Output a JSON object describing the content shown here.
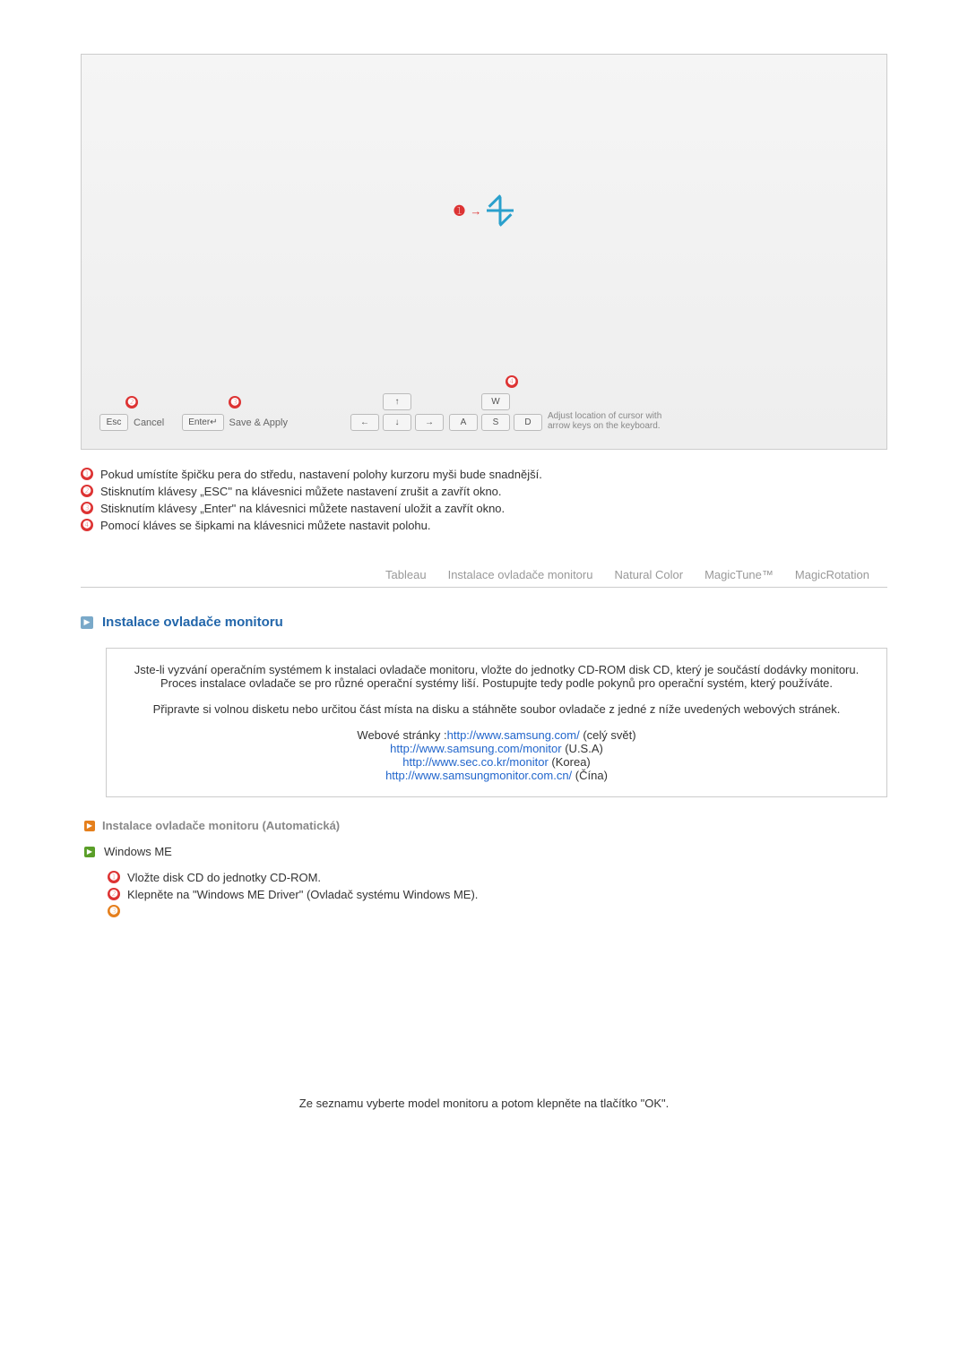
{
  "calibration_panel": {
    "marker_label_1": "➊",
    "footer": {
      "marker_2": "➋",
      "marker_3": "➌",
      "marker_4": "➍",
      "esc_key": "Esc",
      "cancel_label": "Cancel",
      "enter_key": "Enter↵",
      "save_apply_label": "Save & Apply",
      "up_key": "↑",
      "left_key": "←",
      "down_key": "↓",
      "right_key": "→",
      "w_key": "W",
      "a_key": "A",
      "s_key": "S",
      "d_key": "D",
      "adjust_text": "Adjust location of cursor with arrow keys on the keyboard."
    }
  },
  "bullets": {
    "item1_num": "➊",
    "item1_text": "Pokud umístíte špičku pera do středu, nastavení polohy kurzoru myši bude snadnější.",
    "item2_num": "➋",
    "item2_text": "Stisknutím klávesy „ESC\" na klávesnici můžete nastavení zrušit a zavřít okno.",
    "item3_num": "➌",
    "item3_text": "Stisknutím klávesy „Enter\" na klávesnici můžete nastavení uložit a zavřít okno.",
    "item4_num": "➍",
    "item4_text": "Pomocí kláves se šipkami na klávesnici můžete nastavit polohu."
  },
  "tabs": {
    "tableau": "Tableau",
    "instalace": "Instalace ovladače monitoru",
    "natural": "Natural Color",
    "magictune": "MagicTune™",
    "magicrotation": "MagicRotation"
  },
  "section": {
    "title": "Instalace ovladače monitoru",
    "info_para1": "Jste-li vyzvání operačním systémem k instalaci ovladače monitoru, vložte do jednotky CD-ROM disk CD, který je součástí dodávky monitoru. Proces instalace ovladače se pro různé operační systémy liší. Postupujte tedy podle pokynů pro operační systém, který používáte.",
    "info_para2": "Připravte si volnou disketu nebo určitou část místa na disku a stáhněte soubor ovladače z jedné z níže uvedených webových stránek.",
    "web_label": "Webové stránky :",
    "links": [
      {
        "url": "http://www.samsung.com/",
        "suffix": " (celý svět)"
      },
      {
        "url": "http://www.samsung.com/monitor",
        "suffix": " (U.S.A)"
      },
      {
        "url": "http://www.sec.co.kr/monitor",
        "suffix": " (Korea)"
      },
      {
        "url": "http://www.samsungmonitor.com.cn/",
        "suffix": " (Čína)"
      }
    ]
  },
  "sub_section": {
    "title": "Instalace ovladače monitoru (Automatická)",
    "os_title": "Windows ME",
    "step1_num": "➊",
    "step1_text": "Vložte disk CD do jednotky CD-ROM.",
    "step2_num": "➋",
    "step2_text": "Klepněte na \"Windows ME Driver\" (Ovladač systému Windows ME).",
    "step3_num": "➌"
  },
  "footnote": "Ze seznamu vyberte model monitoru a potom klepněte na tlačítko \"OK\"."
}
